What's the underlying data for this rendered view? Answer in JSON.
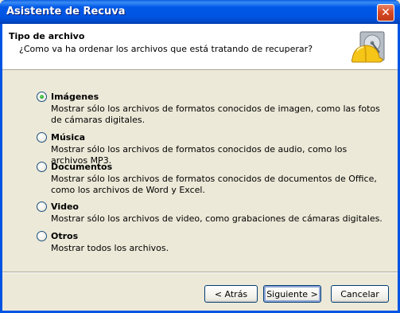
{
  "window": {
    "title": "Asistente de Recuva",
    "close_symbol": "✕"
  },
  "header": {
    "title": "Tipo de archivo",
    "subtitle": "¿Como va ha ordenar los archivos que está tratando de recuperar?",
    "icon": "hard-drive-helmet-icon"
  },
  "options": [
    {
      "label": "Imágenes",
      "description": "Mostrar sólo los archivos de formatos conocidos de imagen, como las fotos de cámaras digitales.",
      "selected": true
    },
    {
      "label": "Música",
      "description": "Mostrar sólo los archivos de formatos conocidos de audio, como los archivos MP3.",
      "selected": false
    },
    {
      "label": "Documentos",
      "description": "Mostrar sólo los archivos de formatos conocidos de documentos de Office, como los archivos de Word y Excel.",
      "selected": false
    },
    {
      "label": "Video",
      "description": "Mostrar sólo los archivos de video, como grabaciones de cámaras digitales.",
      "selected": false
    },
    {
      "label": "Otros",
      "description": "Mostrar todos los archivos.",
      "selected": false
    }
  ],
  "buttons": {
    "back": "< Atrás",
    "next": "Siguiente >",
    "cancel": "Cancelar"
  },
  "colors": {
    "titlebar": "#0054E3",
    "dialog_bg": "#ECE9D8",
    "radio_dot": "#21A121"
  }
}
